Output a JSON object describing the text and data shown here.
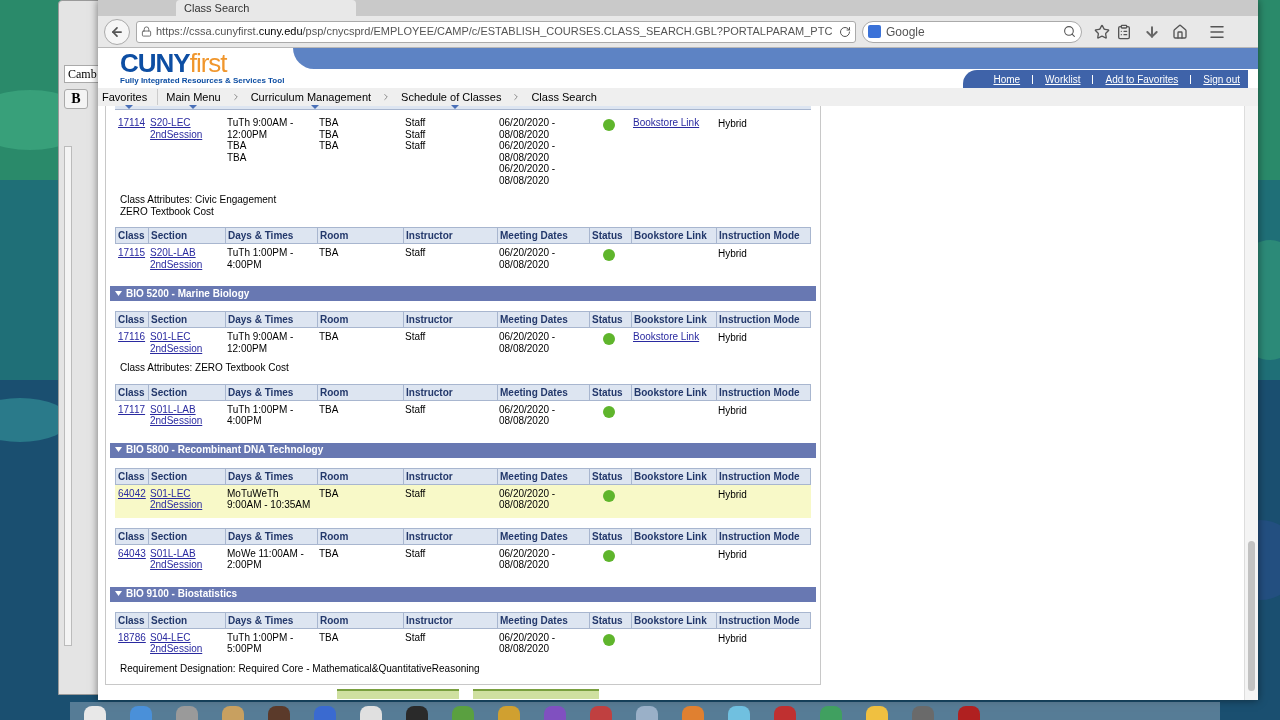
{
  "browser": {
    "tab_title": "Class Search",
    "url_host_prefix": "https://cssa.cunyfirst.",
    "url_host_domain": "cuny.edu",
    "url_path": "/psp/cnycsprd/EMPLOYEE/CAMP/c/ESTABLISH_COURSES.CLASS_SEARCH.GBL?PORTALPARAM_PTC",
    "search_placeholder": "Google"
  },
  "background_window": {
    "font_field": "Camb",
    "bold_button": "B"
  },
  "header": {
    "brand_main": "CUNY",
    "brand_accent": "first",
    "tagline": "Fully Integrated Resources & Services Tool",
    "links": [
      "Home",
      "Worklist",
      "Add to Favorites",
      "Sign out"
    ]
  },
  "breadcrumbs": [
    {
      "label": "Favorites",
      "has_menu": true
    },
    {
      "label": "Main Menu",
      "has_menu": true
    },
    {
      "label": "Curriculum Management",
      "has_menu": true
    },
    {
      "label": "Schedule of Classes",
      "has_menu": true
    },
    {
      "label": "Class Search",
      "has_menu": false
    }
  ],
  "sections": [
    {
      "tables": [
        {
          "rows": [
            {
              "class_nbr": "17114",
              "section": "S20-LEC",
              "session": "2ndSession",
              "days": [
                "TuTh 9:00AM - 12:00PM",
                "TBA",
                "TBA"
              ],
              "rooms": [
                "TBA",
                "TBA",
                "TBA"
              ],
              "instructors": [
                "Staff",
                "Staff",
                "Staff"
              ],
              "dates": [
                "06/20/2020 - 08/08/2020",
                "06/20/2020 - 08/08/2020",
                "06/20/2020 - 08/08/2020"
              ],
              "open": true,
              "bookstore": "Bookstore Link",
              "mode": "Hybrid",
              "highlighted": false
            }
          ],
          "note_lines": [
            "Class Attributes: Civic Engagement",
            "ZERO Textbook Cost"
          ]
        },
        {
          "columns": [
            "Class",
            "Section",
            "Days & Times",
            "Room",
            "Instructor",
            "Meeting Dates",
            "Status",
            "Bookstore Link",
            "Instruction Mode"
          ],
          "rows": [
            {
              "class_nbr": "17115",
              "section": "S20L-LAB",
              "session": "2ndSession",
              "days": [
                "TuTh 1:00PM - 4:00PM"
              ],
              "rooms": [
                "TBA"
              ],
              "instructors": [
                "Staff"
              ],
              "dates": [
                "06/20/2020 - 08/08/2020"
              ],
              "open": true,
              "mode": "Hybrid",
              "highlighted": false
            }
          ]
        }
      ]
    },
    {
      "title": "BIO 5200 - Marine Biology",
      "expanded": true,
      "tables": [
        {
          "columns": [
            "Class",
            "Section",
            "Days & Times",
            "Room",
            "Instructor",
            "Meeting Dates",
            "Status",
            "Bookstore Link",
            "Instruction Mode"
          ],
          "rows": [
            {
              "class_nbr": "17116",
              "section": "S01-LEC",
              "session": "2ndSession",
              "days": [
                "TuTh 9:00AM - 12:00PM"
              ],
              "rooms": [
                "TBA"
              ],
              "instructors": [
                "Staff"
              ],
              "dates": [
                "06/20/2020 - 08/08/2020"
              ],
              "open": true,
              "bookstore": "Bookstore Link",
              "mode": "Hybrid",
              "highlighted": false
            }
          ],
          "note_lines": [
            "Class Attributes: ZERO Textbook Cost"
          ]
        },
        {
          "columns": [
            "Class",
            "Section",
            "Days & Times",
            "Room",
            "Instructor",
            "Meeting Dates",
            "Status",
            "Bookstore Link",
            "Instruction Mode"
          ],
          "rows": [
            {
              "class_nbr": "17117",
              "section": "S01L-LAB",
              "session": "2ndSession",
              "days": [
                "TuTh 1:00PM - 4:00PM"
              ],
              "rooms": [
                "TBA"
              ],
              "instructors": [
                "Staff"
              ],
              "dates": [
                "06/20/2020 - 08/08/2020"
              ],
              "open": true,
              "mode": "Hybrid",
              "highlighted": false
            }
          ]
        }
      ]
    },
    {
      "title": "BIO 5800 - Recombinant DNA Technology",
      "expanded": true,
      "tables": [
        {
          "columns": [
            "Class",
            "Section",
            "Days & Times",
            "Room",
            "Instructor",
            "Meeting Dates",
            "Status",
            "Bookstore Link",
            "Instruction Mode"
          ],
          "rows": [
            {
              "class_nbr": "64042",
              "section": "S01-LEC",
              "session": "2ndSession",
              "days": [
                "MoTuWeTh 9:00AM - 10:35AM"
              ],
              "rooms": [
                "TBA"
              ],
              "instructors": [
                "Staff"
              ],
              "dates": [
                "06/20/2020 - 08/08/2020"
              ],
              "open": true,
              "mode": "Hybrid",
              "highlighted": true
            }
          ]
        },
        {
          "columns": [
            "Class",
            "Section",
            "Days & Times",
            "Room",
            "Instructor",
            "Meeting Dates",
            "Status",
            "Bookstore Link",
            "Instruction Mode"
          ],
          "rows": [
            {
              "class_nbr": "64043",
              "section": "S01L-LAB",
              "session": "2ndSession",
              "days": [
                "MoWe 11:00AM - 2:00PM"
              ],
              "rooms": [
                "TBA"
              ],
              "instructors": [
                "Staff"
              ],
              "dates": [
                "06/20/2020 - 08/08/2020"
              ],
              "open": true,
              "mode": "Hybrid",
              "highlighted": false
            }
          ]
        }
      ]
    },
    {
      "title": "BIO 9100 - Biostatistics",
      "expanded": true,
      "tables": [
        {
          "columns": [
            "Class",
            "Section",
            "Days & Times",
            "Room",
            "Instructor",
            "Meeting Dates",
            "Status",
            "Bookstore Link",
            "Instruction Mode"
          ],
          "rows": [
            {
              "class_nbr": "18786",
              "section": "S04-LEC",
              "session": "2ndSession",
              "days": [
                "TuTh 1:00PM - 5:00PM"
              ],
              "rooms": [
                "TBA"
              ],
              "instructors": [
                "Staff"
              ],
              "dates": [
                "06/20/2020 - 08/08/2020"
              ],
              "open": true,
              "mode": "Hybrid",
              "highlighted": false
            }
          ],
          "note_lines": [
            "Requirement Designation: Required Core - Mathematical&QuantitativeReasoning"
          ]
        }
      ]
    }
  ]
}
